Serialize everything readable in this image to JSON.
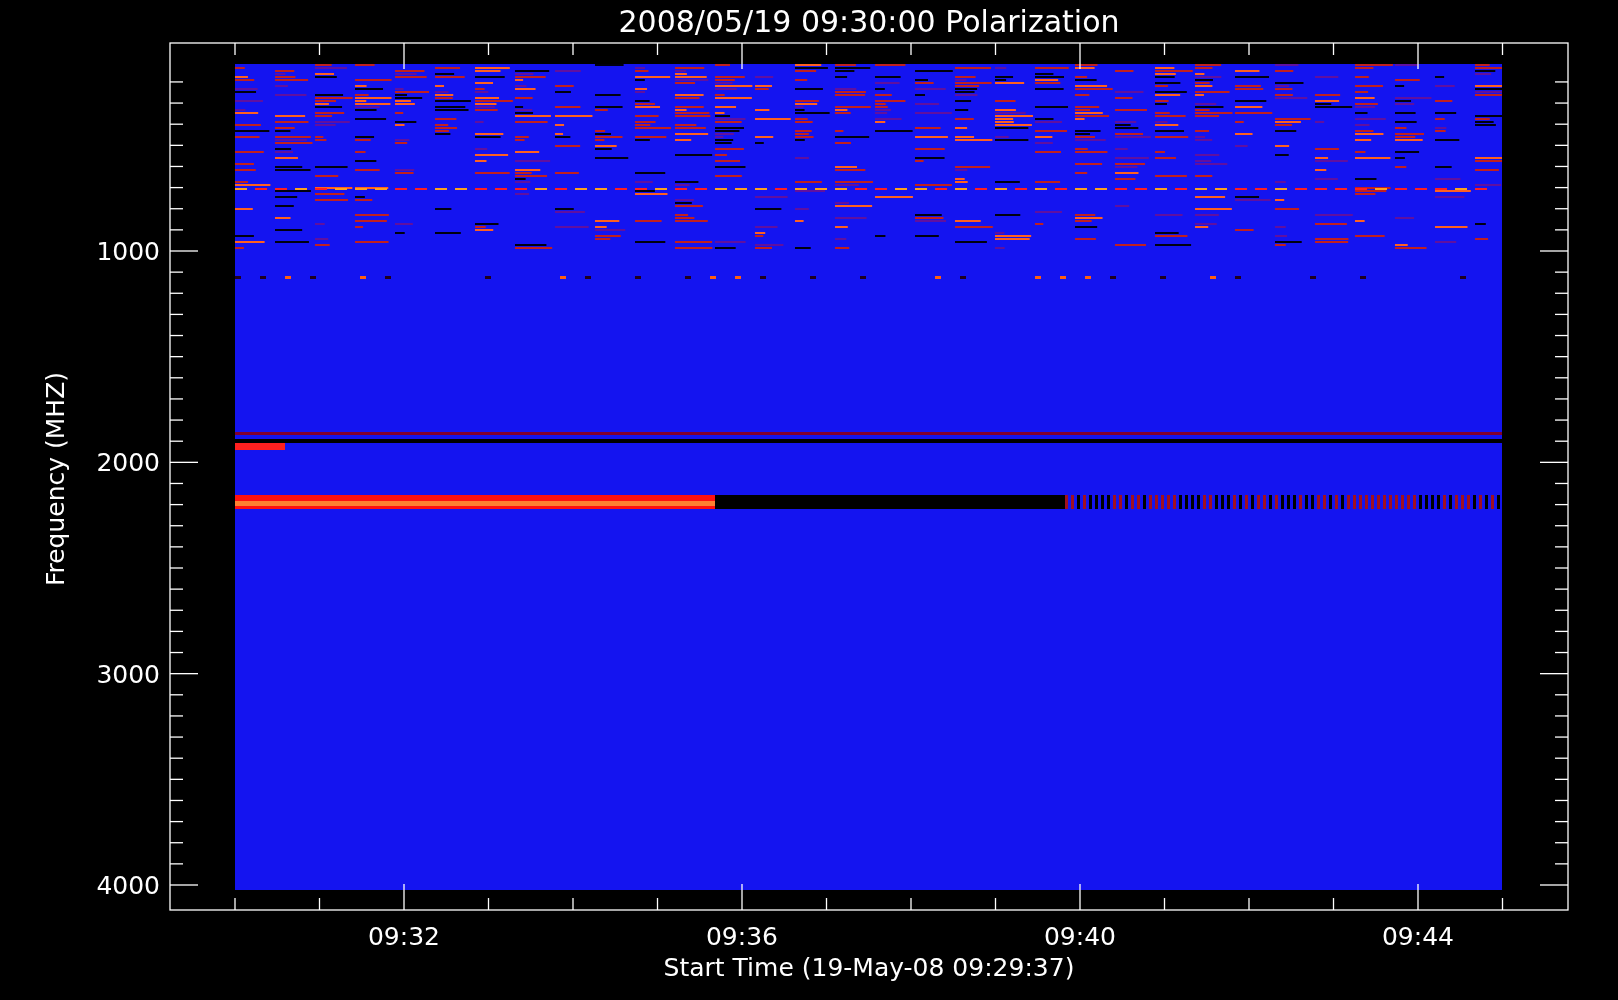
{
  "plot": {
    "title": "2008/05/19 09:30:00 Polarization",
    "y_axis": {
      "label": "Frequency (MHZ)",
      "ticks": [
        "1000",
        "2000",
        "3000",
        "4000"
      ]
    },
    "x_axis": {
      "label": "Start Time (19-May-08 09:29:37)",
      "ticks": [
        "09:32",
        "09:36",
        "09:40",
        "09:44"
      ]
    }
  }
}
